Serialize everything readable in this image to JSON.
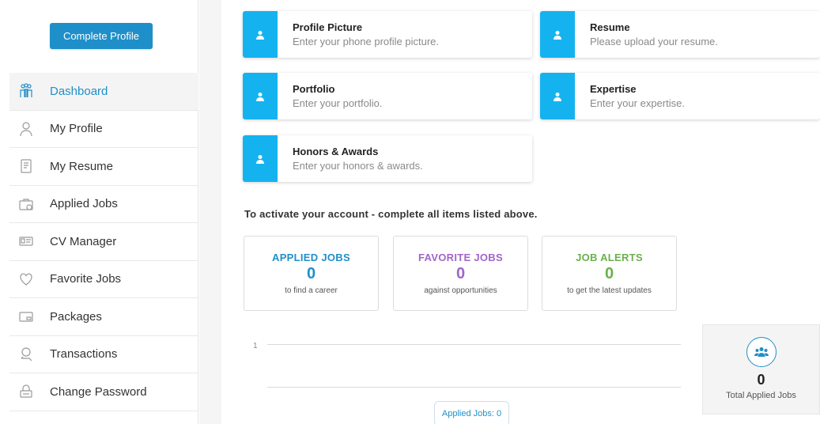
{
  "sidebar": {
    "complete_profile_label": "Complete Profile",
    "items": [
      {
        "label": "Dashboard",
        "icon": "dashboard-icon",
        "active": true
      },
      {
        "label": "My Profile",
        "icon": "user-icon"
      },
      {
        "label": "My Resume",
        "icon": "document-icon"
      },
      {
        "label": "Applied Jobs",
        "icon": "briefcase-icon"
      },
      {
        "label": "CV Manager",
        "icon": "id-card-icon"
      },
      {
        "label": "Favorite Jobs",
        "icon": "heart-icon"
      },
      {
        "label": "Packages",
        "icon": "card-icon"
      },
      {
        "label": "Transactions",
        "icon": "transaction-icon"
      },
      {
        "label": "Change Password",
        "icon": "lock-icon"
      }
    ]
  },
  "profile_items": [
    {
      "title": "Profile Picture",
      "subtitle": "Enter your phone profile picture."
    },
    {
      "title": "Resume",
      "subtitle": "Please upload your resume."
    },
    {
      "title": "Portfolio",
      "subtitle": "Enter your portfolio."
    },
    {
      "title": "Expertise",
      "subtitle": "Enter your expertise."
    },
    {
      "title": "Honors & Awards",
      "subtitle": "Enter your honors & awards."
    }
  ],
  "activate_text": "To activate your account - complete all items listed above.",
  "stats": [
    {
      "heading": "APPLIED JOBS",
      "value": "0",
      "caption": "to find a career",
      "color": "#1f8fc9"
    },
    {
      "heading": "FAVORITE JOBS",
      "value": "0",
      "caption": "against opportunities",
      "color": "#a066c8"
    },
    {
      "heading": "JOB ALERTS",
      "value": "0",
      "caption": "to get the latest updates",
      "color": "#6ab04c"
    }
  ],
  "chart": {
    "tick_label": "1",
    "tooltip": "Applied Jobs: 0"
  },
  "total": {
    "value": "0",
    "caption": "Total Applied Jobs",
    "icon": "users-icon"
  },
  "colors": {
    "accent": "#1f8fc9",
    "badge": "#14b3f0"
  }
}
